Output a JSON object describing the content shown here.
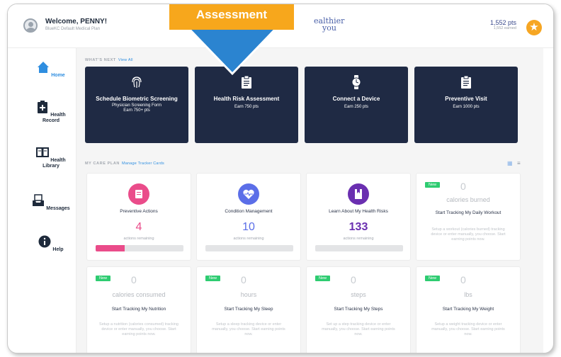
{
  "header": {
    "welcome": "Welcome, PENNY!",
    "plan": "BlueKC Default Medical Plan",
    "logo_line1": "ealthier",
    "logo_line2": "you",
    "points": "1,552 pts",
    "points_earned": "1,552 earned"
  },
  "callout": {
    "label": "Assessment",
    "color": "#f7a71c",
    "arrow_color": "#2b84d0"
  },
  "sidebar": {
    "items": [
      {
        "label": "Home",
        "icon": "home-icon"
      },
      {
        "label": "Health Record",
        "icon": "clipboard-plus-icon"
      },
      {
        "label": "Health Library",
        "icon": "book-icon"
      },
      {
        "label": "Messages",
        "icon": "inbox-icon"
      },
      {
        "label": "Help",
        "icon": "info-icon"
      }
    ]
  },
  "whats_next": {
    "label": "WHAT'S NEXT",
    "link": "View All",
    "cards": [
      {
        "title": "Schedule Biometric Screening",
        "sub1": "Physician Screening Form",
        "sub2": "Earn 750+ pts",
        "icon": "fingerprint-icon"
      },
      {
        "title": "Health Risk Assessment",
        "sub1": "Earn 750 pts",
        "icon": "clipboard-icon"
      },
      {
        "title": "Connect a Device",
        "sub1": "Earn 250 pts",
        "icon": "watch-icon"
      },
      {
        "title": "Preventive Visit",
        "sub1": "Earn 1000 pts",
        "icon": "clipboard-icon"
      }
    ]
  },
  "care_plan": {
    "label": "MY CARE PLAN",
    "link": "Manage Tracker Cards",
    "cards": [
      {
        "title": "Preventive Actions",
        "value": "4",
        "remaining": "actions remaining",
        "color": "#ea4c8a",
        "progress": 0.33,
        "icon": "calendar-icon"
      },
      {
        "title": "Condition Management",
        "value": "10",
        "remaining": "actions remaining",
        "color": "#5b6ee8",
        "progress": 0,
        "icon": "heart-pulse-icon"
      },
      {
        "title": "Learn About My Health Risks",
        "value": "133",
        "remaining": "actions remaining",
        "color": "#6a2fb0",
        "progress": 0,
        "icon": "book-bookmark-icon"
      }
    ],
    "trackers": [
      {
        "badge": "New",
        "value": "0",
        "unit": "calories burned",
        "title": "Start Tracking My Daily Workout",
        "desc": "Setup a workout (calories burned) tracking device or enter manually, you choose. Start earning points now."
      },
      {
        "badge": "New",
        "value": "0",
        "unit": "calories consumed",
        "title": "Start Tracking My Nutrition",
        "desc": "Setup a nutrition (calories consumed) tracking device or enter manually, you choose. Start earning points now."
      },
      {
        "badge": "New",
        "value": "0",
        "unit": "hours",
        "title": "Start Tracking My Sleep",
        "desc": "Setup a sleep tracking device or enter manually, you choose. Start earning points now."
      },
      {
        "badge": "New",
        "value": "0",
        "unit": "steps",
        "title": "Start Tracking My Steps",
        "desc": "Set up a step tracking device or enter manually, you choose. Start earning points now."
      },
      {
        "badge": "New",
        "value": "0",
        "unit": "lbs",
        "title": "Start Tracking My Weight",
        "desc": "Setup a weight tracking device or enter manually, you choose. Start earning points now."
      }
    ]
  }
}
